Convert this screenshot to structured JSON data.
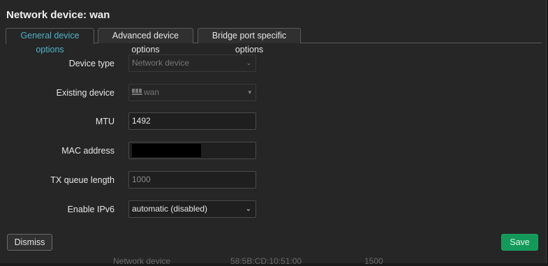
{
  "dialog": {
    "title": "Network device: wan"
  },
  "tabs": [
    {
      "label": "General device options",
      "active": true
    },
    {
      "label": "Advanced device options",
      "active": false
    },
    {
      "label": "Bridge port specific options",
      "active": false
    }
  ],
  "form": {
    "device_type": {
      "label": "Device type",
      "value": "Network device",
      "disabled": true
    },
    "existing_device": {
      "label": "Existing device",
      "value": "wan",
      "icon": "network-port-icon",
      "disabled": true
    },
    "mtu": {
      "label": "MTU",
      "value": "1492"
    },
    "mac_address": {
      "label": "MAC address",
      "value": ""
    },
    "tx_queue_length": {
      "label": "TX queue length",
      "placeholder": "1000"
    },
    "enable_ipv6": {
      "label": "Enable IPv6",
      "value": "automatic (disabled)"
    }
  },
  "buttons": {
    "dismiss": "Dismiss",
    "save": "Save"
  },
  "background": {
    "row_type": "Network device",
    "row_mac": "58:5B:CD:10:51:00",
    "row_mtu": "1500"
  },
  "colors": {
    "active_tab": "#4fb3c9",
    "save_button": "#13995a"
  }
}
